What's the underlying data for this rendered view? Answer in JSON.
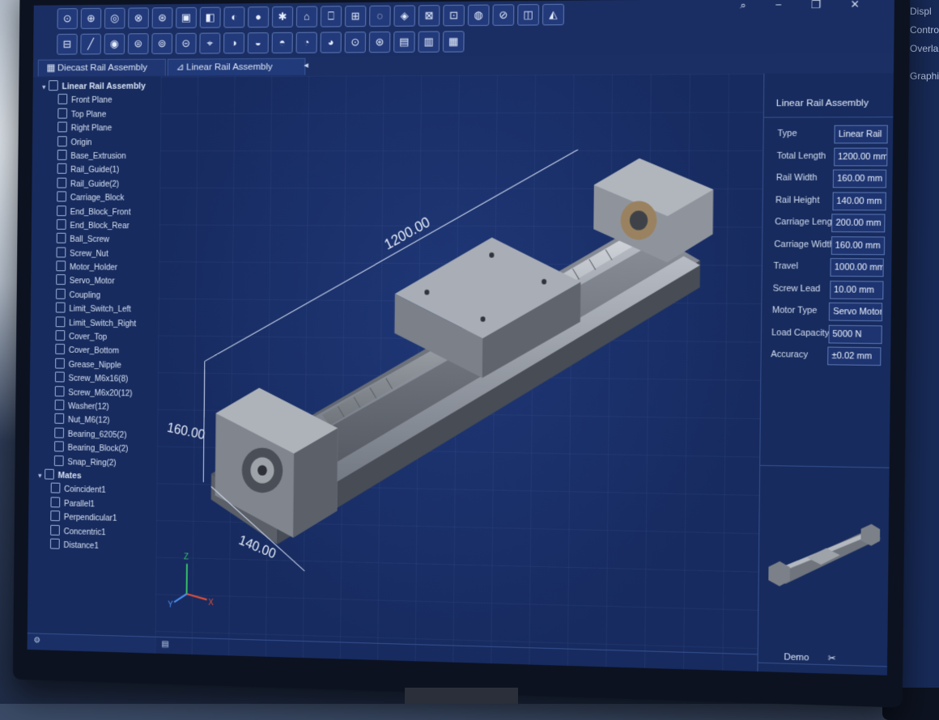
{
  "app": {
    "tabs": [
      {
        "label": "Diecast Rail Assembly"
      },
      {
        "label": "Linear Rail Assembly"
      }
    ],
    "toolbar": {
      "row1": [
        "⊙",
        "⊕",
        "◎",
        "⊗",
        "⊛",
        "▣",
        "◧",
        "◐",
        "●",
        "✱",
        "⌂",
        "⎕",
        "⊞",
        "◌",
        "◈",
        "⊠",
        "⊡",
        "◍",
        "⊘",
        "◫",
        "◭"
      ],
      "row2": [
        "⊟",
        "╱",
        "◉",
        "⊜",
        "⊚",
        "⊝",
        "⌖",
        "◑",
        "◒",
        "◓",
        "◔",
        "◕",
        "⊙",
        "⊛",
        "▤",
        "▥",
        "▦"
      ]
    }
  },
  "tree": {
    "root": "Linear Rail Assembly",
    "items": [
      "Front Plane",
      "Top Plane",
      "Right Plane",
      "Origin",
      "Base_Extrusion",
      "Rail_Guide(1)",
      "Rail_Guide(2)",
      "Carriage_Block",
      "End_Block_Front",
      "End_Block_Rear",
      "Ball_Screw",
      "Screw_Nut",
      "Motor_Holder",
      "Servo_Motor",
      "Coupling",
      "Limit_Switch_Left",
      "Limit_Switch_Right",
      "Cover_Top",
      "Cover_Bottom",
      "Grease_Nipple",
      "Screw_M6x16(8)",
      "Screw_M6x20(12)",
      "Washer(12)",
      "Nut_M6(12)",
      "Bearing_6205(2)",
      "Bearing_Block(2)",
      "Snap_Ring(2)"
    ],
    "mates_label": "Mates",
    "mates": [
      "Coincident1",
      "Parallel1",
      "Perpendicular1",
      "Concentric1",
      "Distance1"
    ]
  },
  "viewport": {
    "dim_length": "1200.00",
    "dim_width": "160.00",
    "dim_height": "140.00",
    "axes": {
      "x": "X",
      "y": "Y",
      "z": "Z"
    }
  },
  "props": {
    "title": "Linear Rail Assembly",
    "rows": [
      {
        "label": "Type",
        "value": "Linear Rail"
      },
      {
        "label": "Total Length",
        "value": "1200.00 mm"
      },
      {
        "label": "Rail Width",
        "value": "160.00 mm"
      },
      {
        "label": "Rail Height",
        "value": "140.00 mm"
      },
      {
        "label": "Carriage Length",
        "value": "200.00 mm"
      },
      {
        "label": "Carriage Width",
        "value": "160.00 mm"
      },
      {
        "label": "Travel",
        "value": "1000.00 mm"
      },
      {
        "label": "Screw Lead",
        "value": "10.00 mm"
      },
      {
        "label": "Motor Type",
        "value": "Servo Motor"
      },
      {
        "label": "Load Capacity",
        "value": "5000 N"
      },
      {
        "label": "Accuracy",
        "value": "±0.02 mm"
      }
    ],
    "footer": "Demo"
  },
  "second_monitor": [
    "Displ",
    "Contro",
    "Overla",
    "Graphi"
  ]
}
